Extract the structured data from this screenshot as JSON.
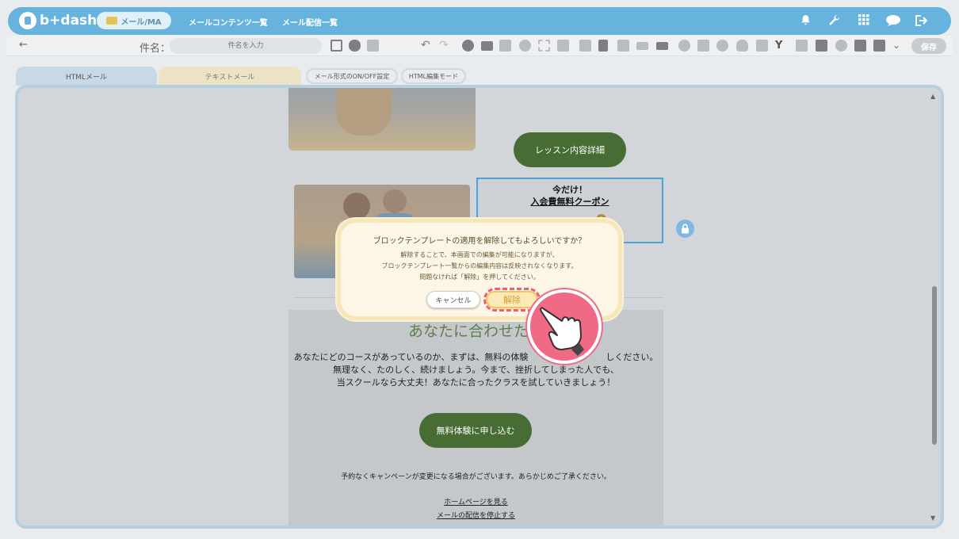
{
  "header": {
    "logo_text": "b+dash",
    "module_pill": "メール/MA",
    "nav": [
      "メールコンテンツ一覧",
      "メール配信一覧"
    ],
    "icons": [
      "bell-icon",
      "wrench-icon",
      "grid-icon",
      "chat-icon",
      "logout-icon"
    ]
  },
  "toolbar": {
    "subject_label": "件名：",
    "subject_placeholder": "件名を入力",
    "save_label": "保存"
  },
  "tabs": {
    "html": "HTMLメール",
    "text": "テキストメール",
    "format_toggle": "メール形式のON/OFF設定",
    "html_edit": "HTML編集モード"
  },
  "email": {
    "lesson_button": "レッスン内容詳細",
    "coupon_line1": "今だけ！",
    "coupon_line2": "入会費無料クーポン",
    "coupon_price": "0",
    "coupon_unit": "円",
    "section_title": "あなたに合わせたコ",
    "body_lines": [
      "あなたにどのコースがあっているのか、まずは、無料の体験",
      "無理なく、たのしく、続けましょう。今まで、挫折してしまった人でも、",
      "当スクールなら大丈夫！あなたに合ったクラスを試していきましょう！"
    ],
    "body_line1_tail": "しください。",
    "trial_button": "無料体験に申し込む",
    "notice": "予約なくキャンペーンが変更になる場合がございます。あらかじめご了承ください。",
    "link_home": "ホームページを見る",
    "link_unsubscribe": "メールの配信を停止する"
  },
  "dialog": {
    "title": "ブロックテンプレートの適用を解除してもよろしいですか？",
    "line1": "解除することで、本画面での編集が可能になりますが、",
    "line2": "ブロックテンプレート一覧からの編集内容は反映されなくなります。",
    "line3": "問題なければ「解除」を押してください。",
    "cancel_label": "キャンセル",
    "release_label": "解除"
  },
  "colors": {
    "header": "#66b4de",
    "accent_green": "#476c34",
    "highlight": "#f05a78"
  }
}
